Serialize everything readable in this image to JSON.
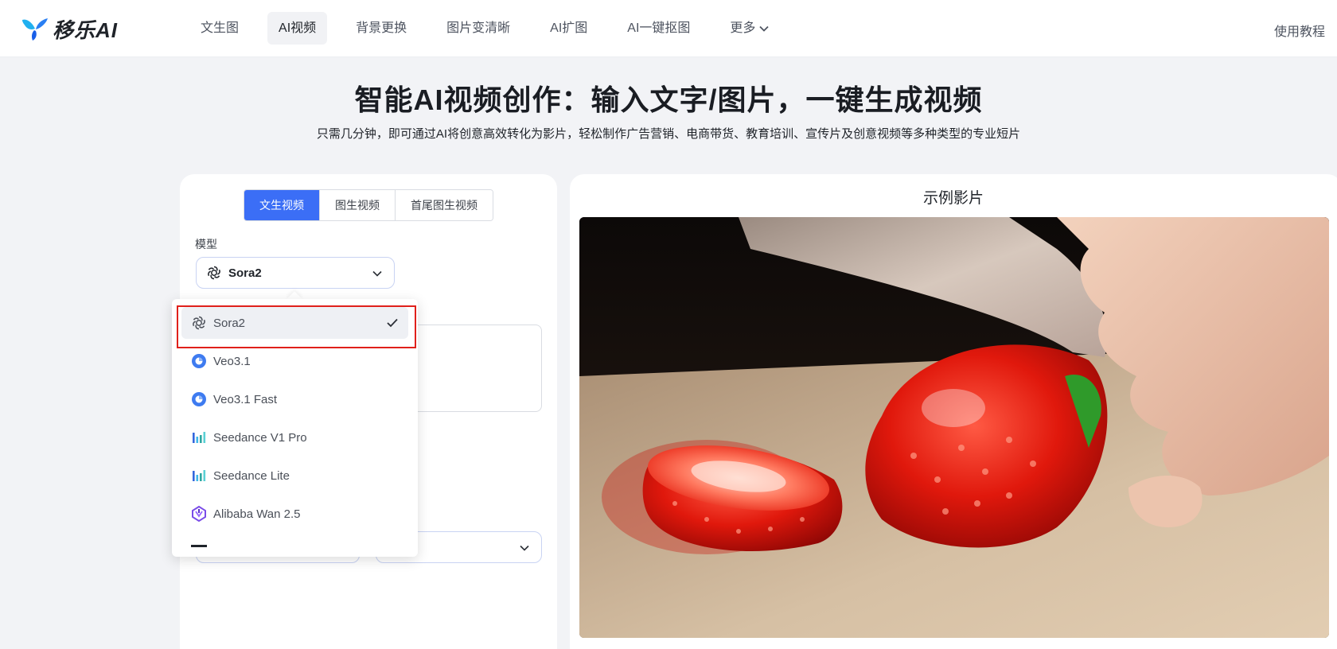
{
  "brand": {
    "name": "移乐AI",
    "accent_color": "#3b6ef6",
    "logo_icon": "butterfly-logo-icon"
  },
  "nav": {
    "items": [
      {
        "label": "文生图"
      },
      {
        "label": "AI视频",
        "active": true
      },
      {
        "label": "背景更换"
      },
      {
        "label": "图片变清晰"
      },
      {
        "label": "AI扩图"
      },
      {
        "label": "AI一键抠图"
      },
      {
        "label": "更多",
        "icon": "chevron-down-icon"
      }
    ],
    "right_link": "使用教程"
  },
  "hero": {
    "title": "智能AI视频创作：输入文字/图片，一键生成视频",
    "subtitle": "只需几分钟，即可通过AI将创意高效转化为影片，轻松制作广告营销、电商带货、教育培训、宣传片及创意视频等多种类型的专业短片"
  },
  "generator": {
    "tabs": [
      {
        "label": "文生视频",
        "active": true
      },
      {
        "label": "图生视频"
      },
      {
        "label": "首尾图生视频"
      }
    ],
    "model_label": "模型",
    "model_selected": "Sora2",
    "model_icon": "openai-icon"
  },
  "model_dropdown": {
    "options": [
      {
        "label": "Sora2",
        "icon": "openai-icon",
        "selected": true
      },
      {
        "label": "Veo3.1",
        "icon": "veo-icon"
      },
      {
        "label": "Veo3.1 Fast",
        "icon": "veo-icon"
      },
      {
        "label": "Seedance V1 Pro",
        "icon": "seedance-icon"
      },
      {
        "label": "Seedance Lite",
        "icon": "seedance-icon"
      },
      {
        "label": "Alibaba Wan 2.5",
        "icon": "wan-icon"
      }
    ],
    "highlight_color": "#e0201b"
  },
  "demo": {
    "title": "示例影片",
    "media": "strawberry-cutting-video-frame"
  }
}
